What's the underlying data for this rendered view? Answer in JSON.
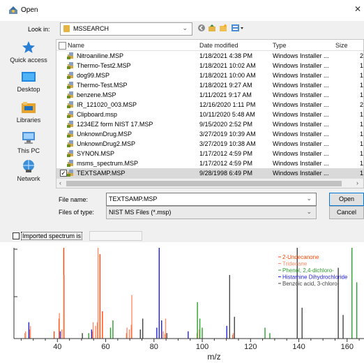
{
  "window": {
    "title": "Open"
  },
  "lookin": {
    "label": "Look in:",
    "folder": "MSSEARCH"
  },
  "places": [
    {
      "label": "Quick access",
      "icon": "star-icon"
    },
    {
      "label": "Desktop",
      "icon": "desktop-icon"
    },
    {
      "label": "Libraries",
      "icon": "libraries-icon"
    },
    {
      "label": "This PC",
      "icon": "computer-icon"
    },
    {
      "label": "Network",
      "icon": "network-icon"
    }
  ],
  "columns": {
    "name": "Name",
    "date": "Date modified",
    "type": "Type",
    "size": "Size"
  },
  "files": [
    {
      "name": "Nitroaniline.MSP",
      "date": "1/18/2021 4:38 PM",
      "type": "Windows Installer ...",
      "size": "2"
    },
    {
      "name": "Thermo-Test2.MSP",
      "date": "1/18/2021 10:02 AM",
      "type": "Windows Installer ...",
      "size": "1"
    },
    {
      "name": "dog99.MSP",
      "date": "1/18/2021 10:00 AM",
      "type": "Windows Installer ...",
      "size": "1"
    },
    {
      "name": "Thermo-Test.MSP",
      "date": "1/18/2021 9:27 AM",
      "type": "Windows Installer ...",
      "size": "1"
    },
    {
      "name": "benzene.MSP",
      "date": "1/11/2021 9:17 AM",
      "type": "Windows Installer ...",
      "size": "1"
    },
    {
      "name": "IR_121020_003.MSP",
      "date": "12/16/2020 1:11 PM",
      "type": "Windows Installer ...",
      "size": "2"
    },
    {
      "name": "Clipboard.msp",
      "date": "10/11/2020 5:48 AM",
      "type": "Windows Installer ...",
      "size": "1"
    },
    {
      "name": "1234EZ form NIST 17.MSP",
      "date": "9/15/2020 2:52 PM",
      "type": "Windows Installer ...",
      "size": "1"
    },
    {
      "name": "UnknownDrug.MSP",
      "date": "3/27/2019 10:39 AM",
      "type": "Windows Installer ...",
      "size": "1"
    },
    {
      "name": "UnknownDrug2.MSP",
      "date": "3/27/2019 10:38 AM",
      "type": "Windows Installer ...",
      "size": "1"
    },
    {
      "name": "SYNON.MSP",
      "date": "1/17/2012 4:59 PM",
      "type": "Windows Installer ...",
      "size": "1"
    },
    {
      "name": "msms_spectrum.MSP",
      "date": "1/17/2012 4:59 PM",
      "type": "Windows Installer ...",
      "size": "1"
    },
    {
      "name": "TEXTSAMP.MSP",
      "date": "9/28/1998 6:49 PM",
      "type": "Windows Installer ...",
      "size": "1",
      "selected": true
    }
  ],
  "filename": {
    "label": "File name:",
    "value": "TEXTSAMP.MSP"
  },
  "filetype": {
    "label": "Files of type:",
    "value": "NIST MS Files (*.msp)"
  },
  "buttons": {
    "open": "Open",
    "cancel": "Cancel"
  },
  "imported": {
    "label": "Imported spectrum is"
  },
  "chart_data": {
    "type": "bar",
    "xlabel": "m/z",
    "xlim": [
      22,
      167
    ],
    "xticks": [
      40,
      60,
      80,
      100,
      120,
      140,
      160
    ],
    "ylim": [
      0,
      100
    ],
    "legend_position": "top-right",
    "series": [
      {
        "name": "2-Undecanone",
        "color": "#ff4500",
        "x": [
          27,
          29,
          39,
          41,
          43,
          55,
          57,
          58,
          59,
          69,
          71,
          85,
          113
        ],
        "y": [
          6,
          10,
          8,
          22,
          100,
          8,
          18,
          93,
          30,
          6,
          15,
          5,
          4
        ]
      },
      {
        "name": "Tridecane",
        "color": "#ff8c69",
        "x": [
          27,
          29,
          41,
          42,
          43,
          55,
          56,
          57,
          69,
          70,
          71,
          84,
          85,
          98,
          99,
          113
        ],
        "y": [
          8,
          14,
          28,
          10,
          70,
          18,
          14,
          100,
          12,
          10,
          48,
          8,
          22,
          6,
          10,
          6
        ]
      },
      {
        "name": "Phenol, 2,4-dichloro-",
        "color": "#2ca02c",
        "x": [
          53,
          62,
          63,
          98,
          99,
          100,
          126,
          128,
          162,
          164
        ],
        "y": [
          6,
          12,
          20,
          40,
          22,
          12,
          12,
          6,
          100,
          62
        ]
      },
      {
        "name": "Histamine Dihydrochloride",
        "color": "#1f1fdf",
        "x": [
          28,
          41,
          54,
          81,
          82,
          83,
          94,
          110
        ],
        "y": [
          18,
          8,
          10,
          12,
          100,
          20,
          8,
          14
        ]
      },
      {
        "name": "Benzoic acid, 3-chloro-",
        "color": "#444444",
        "x": [
          50,
          74,
          75,
          85,
          111,
          113,
          139,
          141,
          156,
          158
        ],
        "y": [
          6,
          10,
          22,
          6,
          70,
          24,
          100,
          34,
          78,
          26
        ]
      }
    ]
  }
}
